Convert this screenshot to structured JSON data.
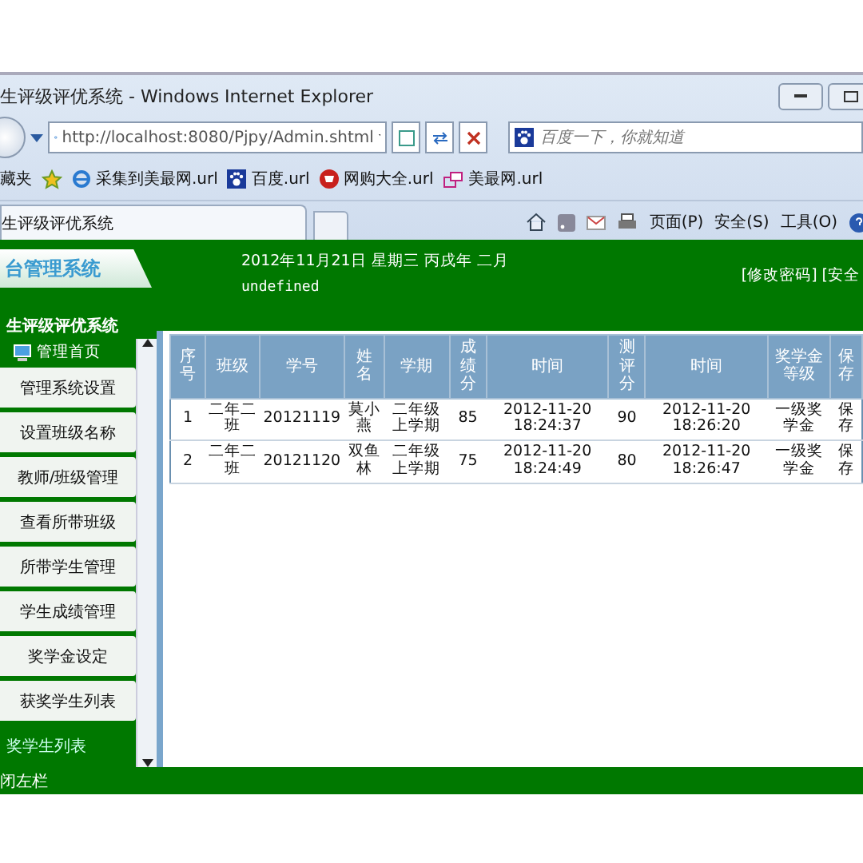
{
  "window": {
    "title": "生评级评优系统 - Windows Internet Explorer"
  },
  "address_bar": {
    "url": "http://localhost:8080/Pjpy/Admin.shtml"
  },
  "search": {
    "placeholder": "百度一下，你就知道"
  },
  "favorites_bar": {
    "label": "藏夹",
    "links": [
      "采集到美最网.url",
      "百度.url",
      "网购大全.url",
      "美最网.url"
    ]
  },
  "tab": {
    "title": "生评级评优系统"
  },
  "command_bar": [
    "页面(P)",
    "安全(S)",
    "工具(O)"
  ],
  "header": {
    "logo": "台管理系统",
    "date": "2012年11月21日 星期三 丙戌年 二月",
    "note": "undefined",
    "links": "[修改密码] [安全"
  },
  "sidebar": {
    "title": "生评级评优系统",
    "home": "管理首页",
    "items": [
      "管理系统设置",
      "设置班级名称",
      "教师/班级管理",
      "查看所带班级",
      "所带学生管理",
      "学生成绩管理",
      "奖学金设定",
      "获奖学生列表"
    ],
    "current": "奖学生列表"
  },
  "table": {
    "columns": [
      "序号",
      "班级",
      "学号",
      "姓名",
      "学期",
      "成绩分",
      "时间",
      "测评分",
      "时间",
      "奖学金等级",
      "保存"
    ],
    "rows": [
      [
        "1",
        "二年二班",
        "20121119",
        "莫小燕",
        "二年级上学期",
        "85",
        "2012-11-20 18:24:37",
        "90",
        "2012-11-20 18:26:20",
        "一级奖学金",
        "保存"
      ],
      [
        "2",
        "二年二班",
        "20121120",
        "双鱼林",
        "二年级上学期",
        "75",
        "2012-11-20 18:24:49",
        "80",
        "2012-11-20 18:26:47",
        "一级奖学金",
        "保存"
      ]
    ]
  },
  "footer": {
    "text": "闭左栏"
  }
}
